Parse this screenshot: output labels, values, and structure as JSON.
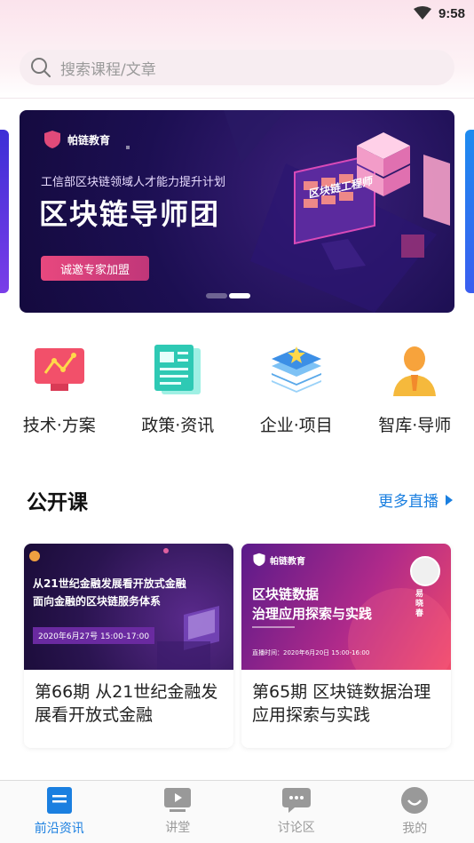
{
  "status": {
    "time": "9:58"
  },
  "search": {
    "placeholder": "搜索课程/文章"
  },
  "banner": {
    "logo": "帕链教育",
    "subtitle": "工信部区块链领域人才能力提升计划",
    "title": "区块链导师团",
    "button": "诚邀专家加盟",
    "screen_label": "区块链工程师"
  },
  "quick_menu": [
    {
      "label": "技术·方案",
      "icon": "chart-monitor-icon"
    },
    {
      "label": "政策·资讯",
      "icon": "document-icon"
    },
    {
      "label": "企业·项目",
      "icon": "layers-star-icon"
    },
    {
      "label": "智库·导师",
      "icon": "mentor-icon"
    }
  ],
  "section": {
    "title": "公开课",
    "more": "更多直播"
  },
  "courses": [
    {
      "thumb_title_1": "从21世纪金融发展看开放式金融",
      "thumb_title_2": "面向金融的区块链服务体系",
      "thumb_date": "2020年6月27号 15:00-17:00",
      "title": "第66期 从21世纪金融发展看开放式金融"
    },
    {
      "thumb_logo": "帕链教育",
      "thumb_title_1": "区块链数据",
      "thumb_title_2": "治理应用探索与实践",
      "thumb_date": "直播时间：2020年6月20日 15:00-16:00",
      "speaker": "易晓春",
      "title": "第65期 区块链数据治理应用探索与实践"
    }
  ],
  "tabs": [
    {
      "label": "前沿资讯",
      "icon": "news-icon",
      "active": true
    },
    {
      "label": "讲堂",
      "icon": "video-icon",
      "active": false
    },
    {
      "label": "讨论区",
      "icon": "chat-icon",
      "active": false
    },
    {
      "label": "我的",
      "icon": "profile-icon",
      "active": false
    }
  ],
  "colors": {
    "accent": "#1a7fe0",
    "banner_bg": "#1c0f52",
    "button_pink": "#e8487e"
  }
}
